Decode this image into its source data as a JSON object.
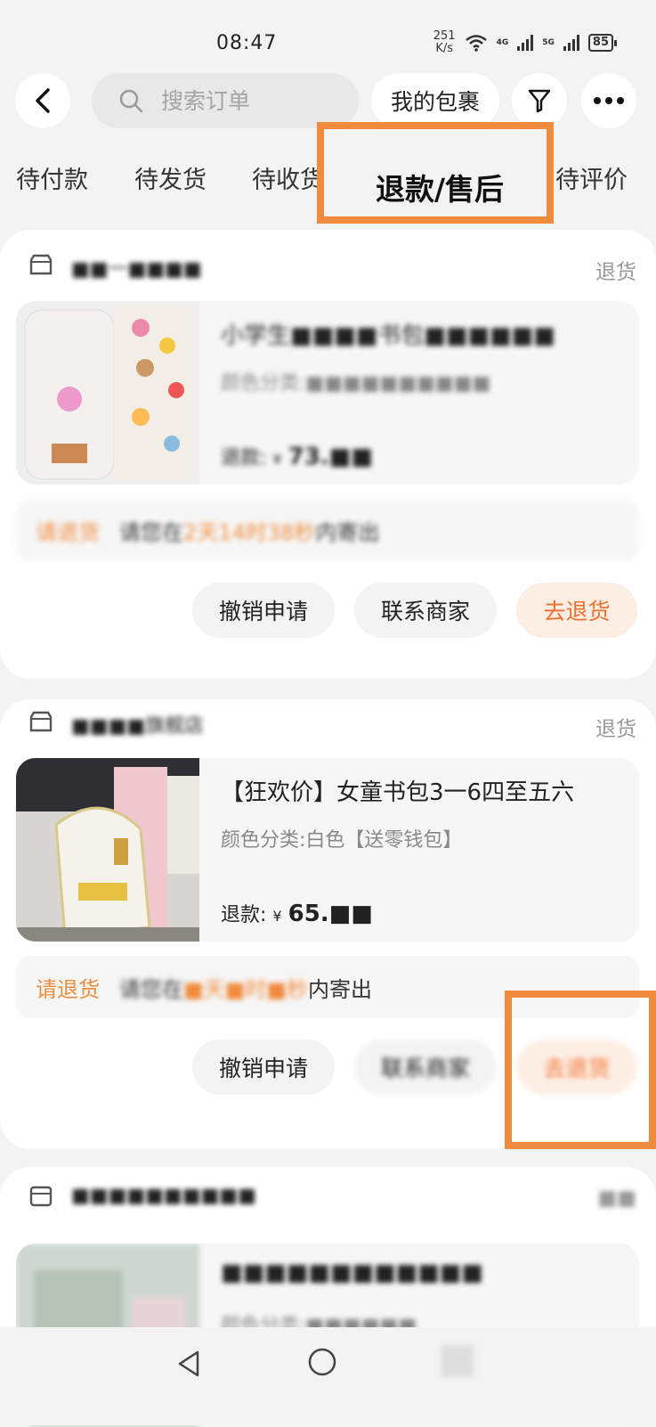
{
  "status_bar": {
    "time": "08:47",
    "speed_value": "251",
    "speed_unit": "K/s",
    "net1": "4G",
    "net2": "5G",
    "battery": "85"
  },
  "header": {
    "search_placeholder": "搜索订单",
    "packages_label": "我的包裹"
  },
  "tabs": [
    {
      "label": "待付款"
    },
    {
      "label": "待发货"
    },
    {
      "label": "待收货"
    },
    {
      "label": "退款/售后",
      "active": true
    },
    {
      "label": "待评价"
    }
  ],
  "orders": [
    {
      "store_name": "■■一■■■■",
      "status": "退货",
      "product_title": "小学生■■■■书包■■■■■■",
      "product_attr": "颜色分类:■■■■■■■■■■",
      "refund_label": "退款:",
      "refund_currency": "¥",
      "refund_amount": "73.■■",
      "notice_label": "请退货",
      "notice_prefix": "请您在",
      "notice_time": "2天14时38秒",
      "notice_suffix": "内寄出",
      "buttons": [
        "撤销申请",
        "联系商家",
        "去退货"
      ]
    },
    {
      "store_name": "■■■■旗舰店",
      "status": "退货",
      "product_title": "【狂欢价】女童书包3一6四至五六",
      "product_attr": "颜色分类:白色【送零钱包】",
      "refund_label": "退款:",
      "refund_currency": "¥",
      "refund_amount": "65.■■",
      "notice_label": "请退货",
      "notice_prefix": "请您在",
      "notice_time": "■天■时■秒",
      "notice_suffix": "内寄出",
      "buttons": [
        "撤销申请",
        "联系商家",
        "去退货"
      ]
    },
    {
      "store_name": "■■■■■■■■■■",
      "status": "■■",
      "product_title": "■■■■■■■■■■■■",
      "product_attr": "颜色分类:■■■■■■"
    }
  ],
  "colors": {
    "accent": "#f08a3c",
    "page_bg": "#f3f3f3"
  }
}
